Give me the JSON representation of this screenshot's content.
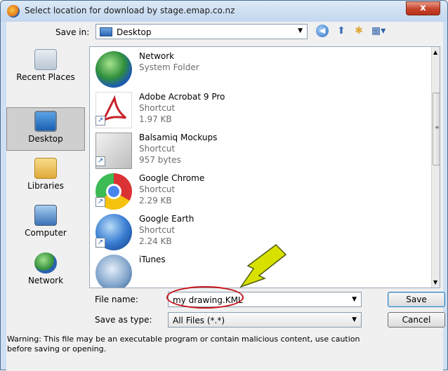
{
  "dialog": {
    "title": "Select location for download by stage.emap.co.nz",
    "close_glyph": "x"
  },
  "toolbar": {
    "save_in_label": "Save in:",
    "save_in_value": "Desktop"
  },
  "places": [
    {
      "label": "Recent Places",
      "icon": "recent-places-icon"
    },
    {
      "label": "Desktop",
      "icon": "desktop-icon"
    },
    {
      "label": "Libraries",
      "icon": "libraries-icon"
    },
    {
      "label": "Computer",
      "icon": "computer-icon"
    },
    {
      "label": "Network",
      "icon": "network-icon"
    }
  ],
  "files": [
    {
      "name": "Network",
      "line2": "System Folder",
      "line3": ""
    },
    {
      "name": "Adobe Acrobat 9 Pro",
      "line2": "Shortcut",
      "line3": "1.97 KB"
    },
    {
      "name": "Balsamiq Mockups",
      "line2": "Shortcut",
      "line3": "957 bytes"
    },
    {
      "name": "Google Chrome",
      "line2": "Shortcut",
      "line3": "2.29 KB"
    },
    {
      "name": "Google Earth",
      "line2": "Shortcut",
      "line3": "2.24 KB"
    },
    {
      "name": "iTunes",
      "line2": "",
      "line3": ""
    }
  ],
  "form": {
    "file_name_label": "File name:",
    "file_name_value": "my drawing.KML",
    "save_as_type_label": "Save as type:",
    "save_as_type_value": "All Files (*.*)",
    "save_button": "Save",
    "cancel_button": "Cancel"
  },
  "warning": {
    "text": "Warning: This file may be an executable program or contain malicious content, use caution before saving or opening."
  },
  "colors": {
    "annotation_circle": "#c5131b",
    "annotation_arrow": "#d8e000"
  }
}
